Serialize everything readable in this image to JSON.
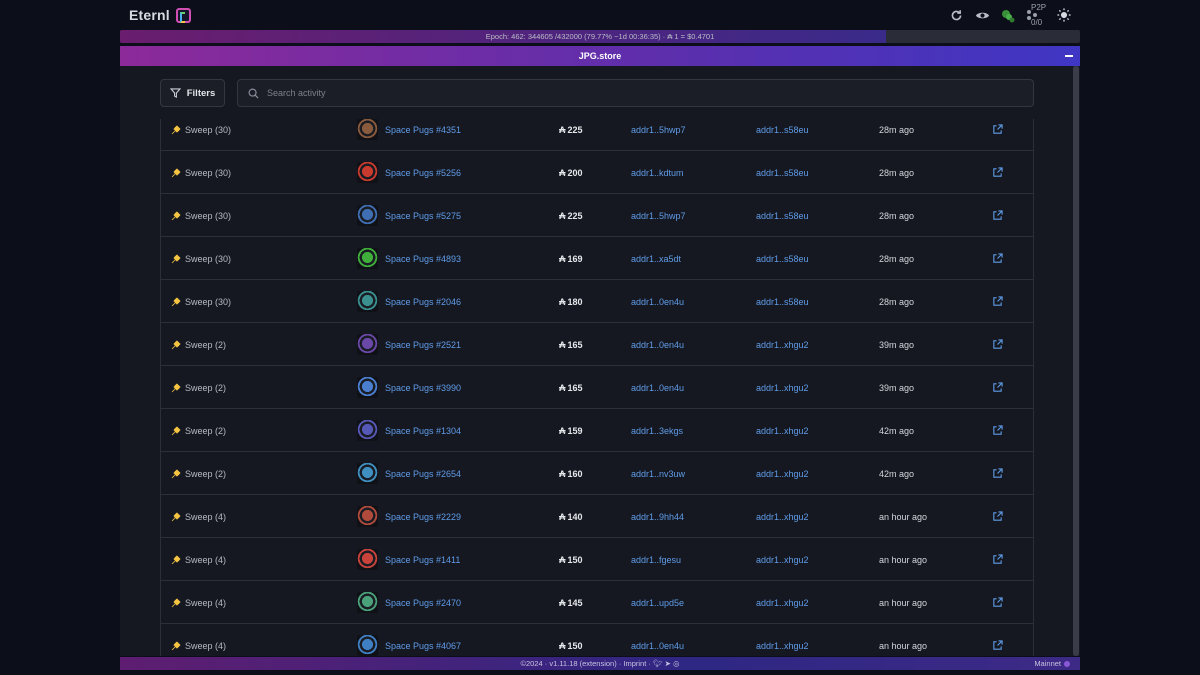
{
  "app": {
    "name": "Eternl"
  },
  "topbar": {
    "p2p_label": "P2P",
    "p2p_count": "0/0"
  },
  "epoch": {
    "text": "Epoch: 462: 344605 /432000 (79.77% ~1d 00:36:35) · ₳ 1 = $0.4701",
    "progress_percent": 79.77
  },
  "panel": {
    "title": "JPG.store"
  },
  "filters": {
    "label": "Filters"
  },
  "search": {
    "placeholder": "Search activity",
    "value": ""
  },
  "activity": {
    "rows": [
      {
        "type": "Sweep (30)",
        "item": "Space Pugs #4351",
        "price": "225",
        "from": "addr1..5hwp7",
        "to": "addr1..s58eu",
        "time": "28m ago",
        "color": "#8a5a3c"
      },
      {
        "type": "Sweep (30)",
        "item": "Space Pugs #5256",
        "price": "200",
        "from": "addr1..kdtum",
        "to": "addr1..s58eu",
        "time": "28m ago",
        "color": "#c93a2e"
      },
      {
        "type": "Sweep (30)",
        "item": "Space Pugs #5275",
        "price": "225",
        "from": "addr1..5hwp7",
        "to": "addr1..s58eu",
        "time": "28m ago",
        "color": "#3f6fb2"
      },
      {
        "type": "Sweep (30)",
        "item": "Space Pugs #4893",
        "price": "169",
        "from": "addr1..xa5dt",
        "to": "addr1..s58eu",
        "time": "28m ago",
        "color": "#3fae3a"
      },
      {
        "type": "Sweep (30)",
        "item": "Space Pugs #2046",
        "price": "180",
        "from": "addr1..0en4u",
        "to": "addr1..s58eu",
        "time": "28m ago",
        "color": "#3a8f8f"
      },
      {
        "type": "Sweep (2)",
        "item": "Space Pugs #2521",
        "price": "165",
        "from": "addr1..0en4u",
        "to": "addr1..xhgu2",
        "time": "39m ago",
        "color": "#6a48a8"
      },
      {
        "type": "Sweep (2)",
        "item": "Space Pugs #3990",
        "price": "165",
        "from": "addr1..0en4u",
        "to": "addr1..xhgu2",
        "time": "39m ago",
        "color": "#4a7fd0"
      },
      {
        "type": "Sweep (2)",
        "item": "Space Pugs #1304",
        "price": "159",
        "from": "addr1..3ekgs",
        "to": "addr1..xhgu2",
        "time": "42m ago",
        "color": "#5658b8"
      },
      {
        "type": "Sweep (2)",
        "item": "Space Pugs #2654",
        "price": "160",
        "from": "addr1..nv3uw",
        "to": "addr1..xhgu2",
        "time": "42m ago",
        "color": "#3f8fc0"
      },
      {
        "type": "Sweep (4)",
        "item": "Space Pugs #2229",
        "price": "140",
        "from": "addr1..9hh44",
        "to": "addr1..xhgu2",
        "time": "an hour ago",
        "color": "#b04a3a"
      },
      {
        "type": "Sweep (4)",
        "item": "Space Pugs #1411",
        "price": "150",
        "from": "addr1..fgesu",
        "to": "addr1..xhgu2",
        "time": "an hour ago",
        "color": "#c9433a"
      },
      {
        "type": "Sweep (4)",
        "item": "Space Pugs #2470",
        "price": "145",
        "from": "addr1..upd5e",
        "to": "addr1..xhgu2",
        "time": "an hour ago",
        "color": "#4aa07a"
      },
      {
        "type": "Sweep (4)",
        "item": "Space Pugs #4067",
        "price": "150",
        "from": "addr1..0en4u",
        "to": "addr1..xhgu2",
        "time": "an hour ago",
        "color": "#3f7fc4"
      }
    ]
  },
  "currency_symbol": "₳",
  "footer": {
    "text": "©2024 · v1.11.18 (extension) · Imprint ·",
    "network": "Mainnet"
  },
  "colors": {
    "accent_purple": "#8c2a9a",
    "link_blue": "#5f9ce8",
    "sweep_icon": "#f5c542"
  }
}
